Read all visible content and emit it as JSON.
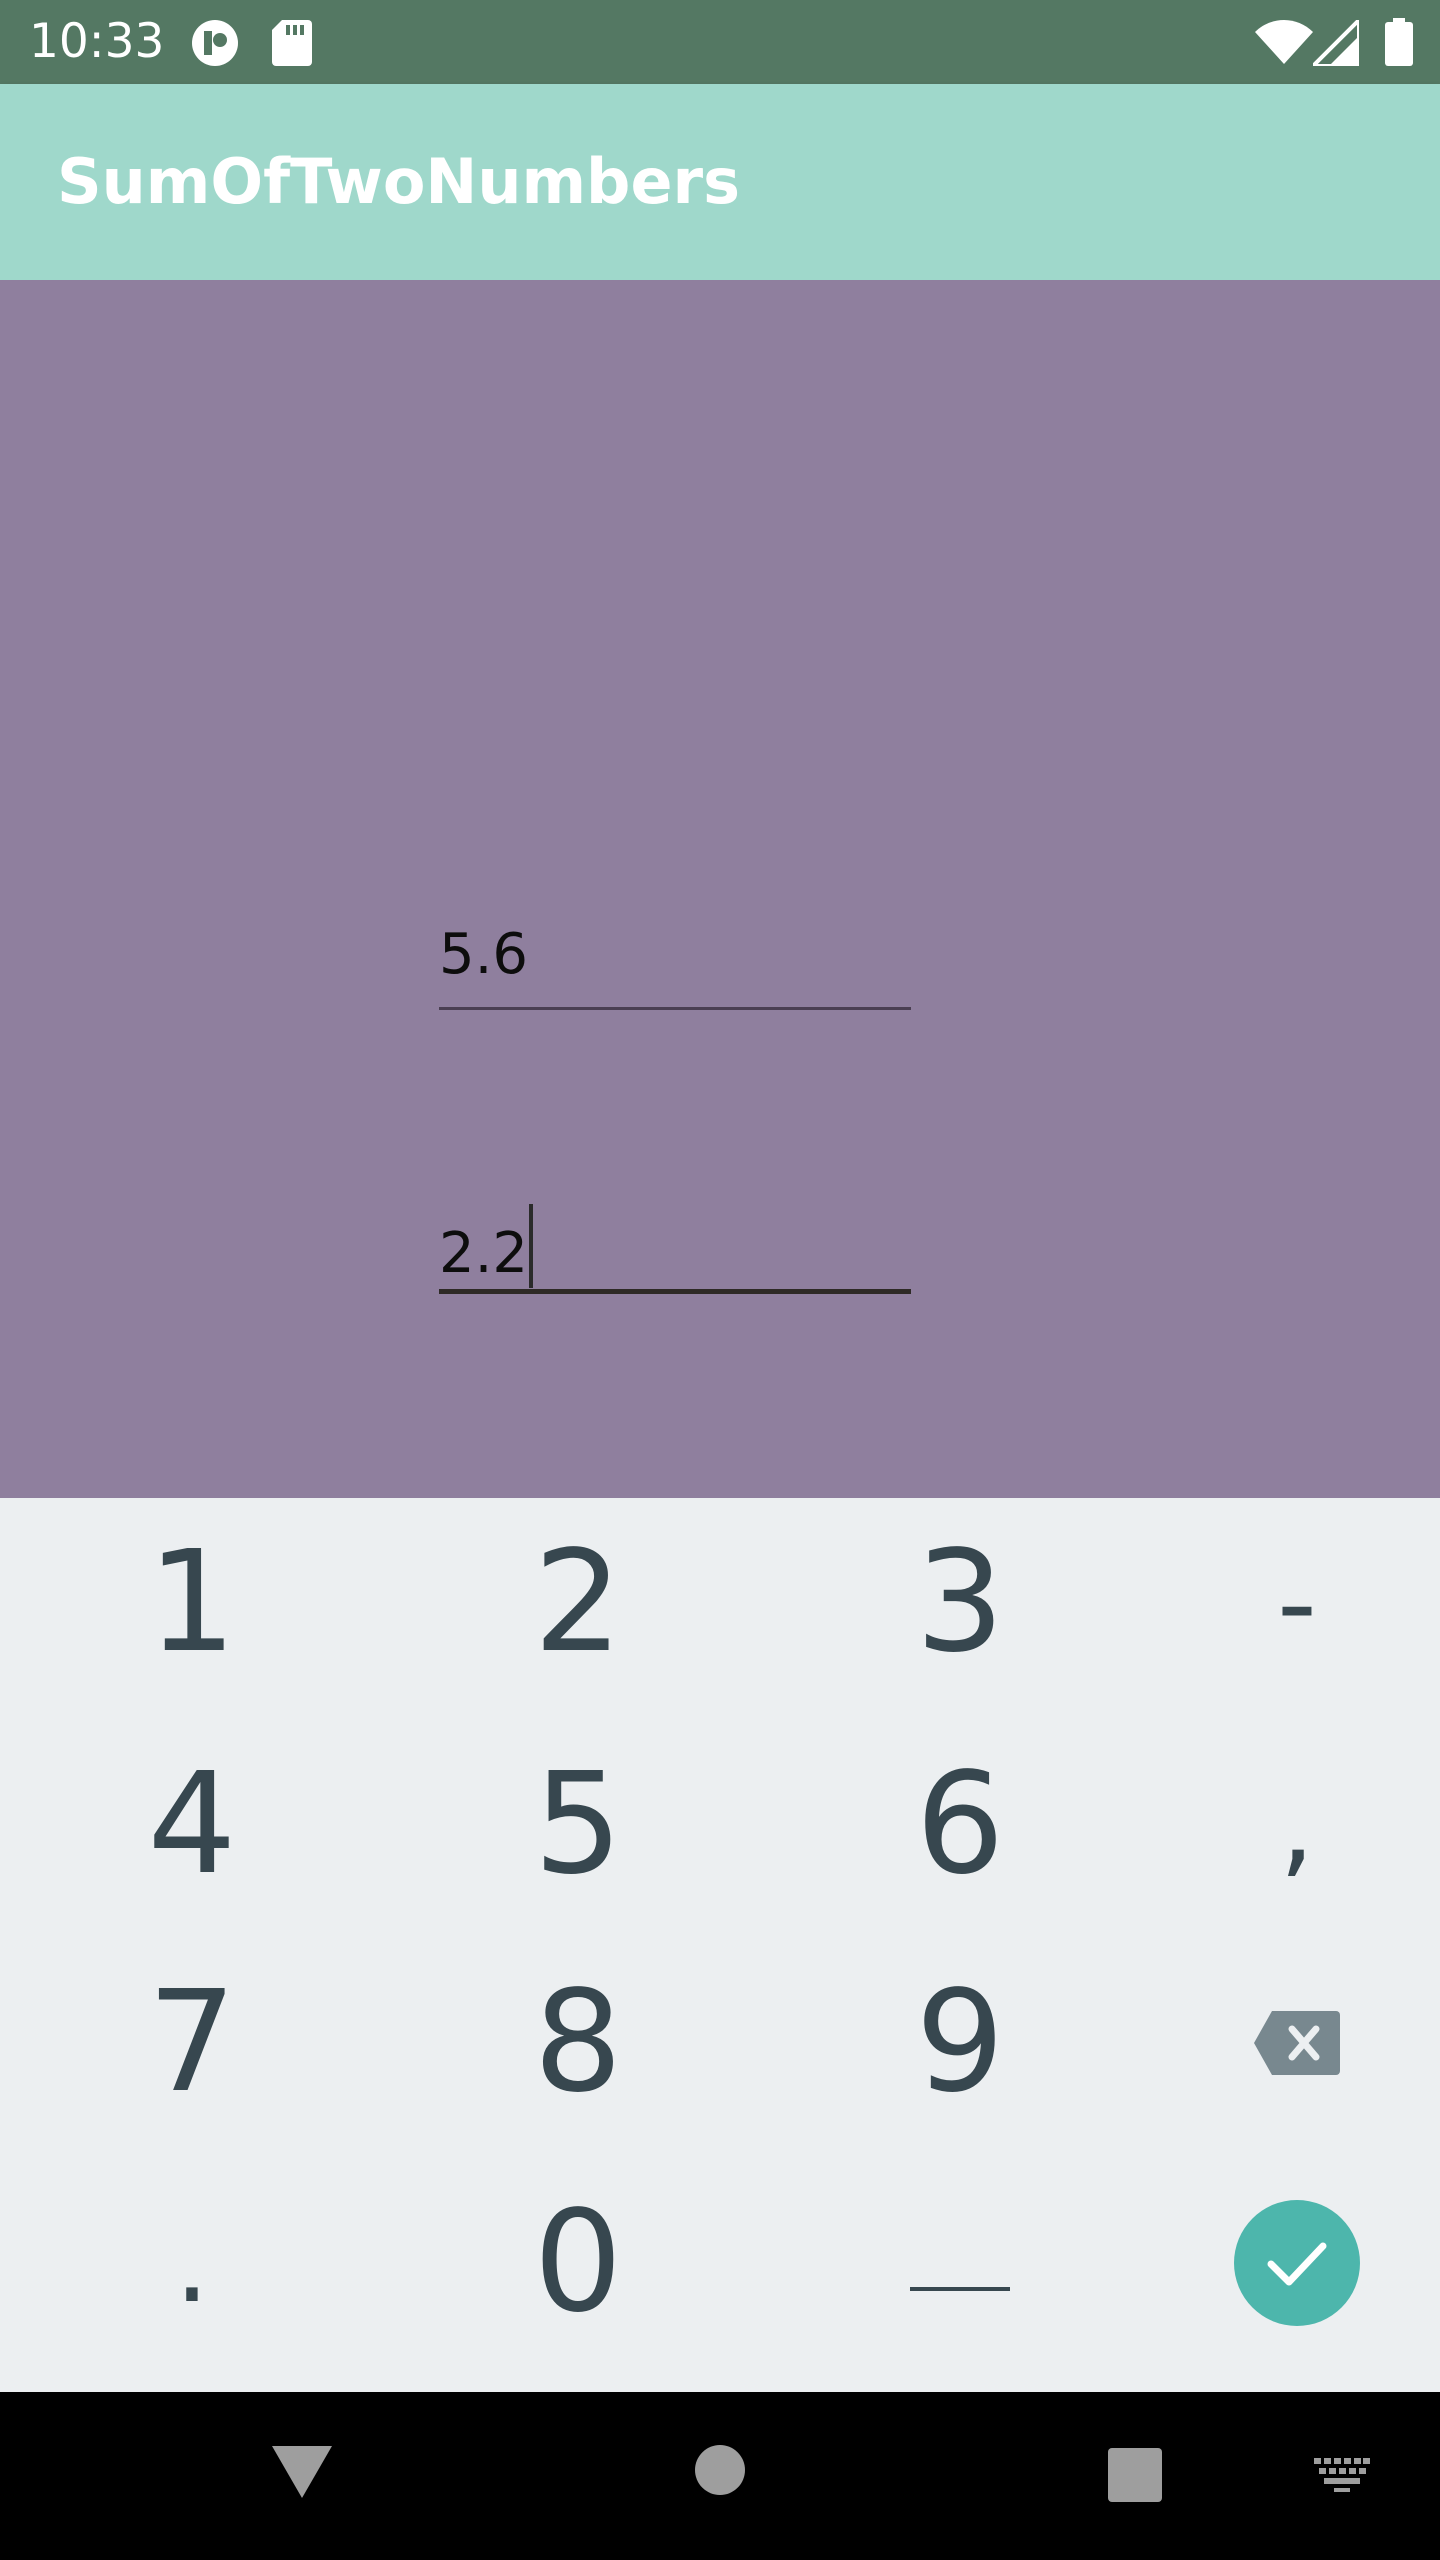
{
  "status_bar": {
    "time": "10:33",
    "icons": [
      "notification-app-icon",
      "sd-card-icon",
      "wifi-icon",
      "cell-signal-icon",
      "battery-icon"
    ]
  },
  "app_bar": {
    "title": "SumOfTwoNumbers"
  },
  "fields": {
    "first_value": "5.6",
    "second_value": "2.2"
  },
  "keyboard": {
    "rows": [
      [
        "1",
        "2",
        "3",
        "-"
      ],
      [
        "4",
        "5",
        "6",
        ","
      ],
      [
        "7",
        "8",
        "9",
        "backspace-icon"
      ],
      [
        ".",
        "0",
        "space-key",
        "enter-check-icon"
      ]
    ],
    "labels": {
      "k1": "1",
      "k2": "2",
      "k3": "3",
      "minus": "-",
      "k4": "4",
      "k5": "5",
      "k6": "6",
      "comma": ",",
      "k7": "7",
      "k8": "8",
      "k9": "9",
      "period": ".",
      "k0": "0"
    }
  },
  "nav_bar": {
    "icons": [
      "back-icon",
      "home-icon",
      "recents-icon",
      "keyboard-switch-icon"
    ]
  },
  "colors": {
    "status_bar": "#547863",
    "app_bar": "#9fd8cb",
    "content": "#8f7f9e",
    "keyboard": "#eceff1",
    "key_text": "#37474f",
    "enter_key": "#4db6ac"
  }
}
